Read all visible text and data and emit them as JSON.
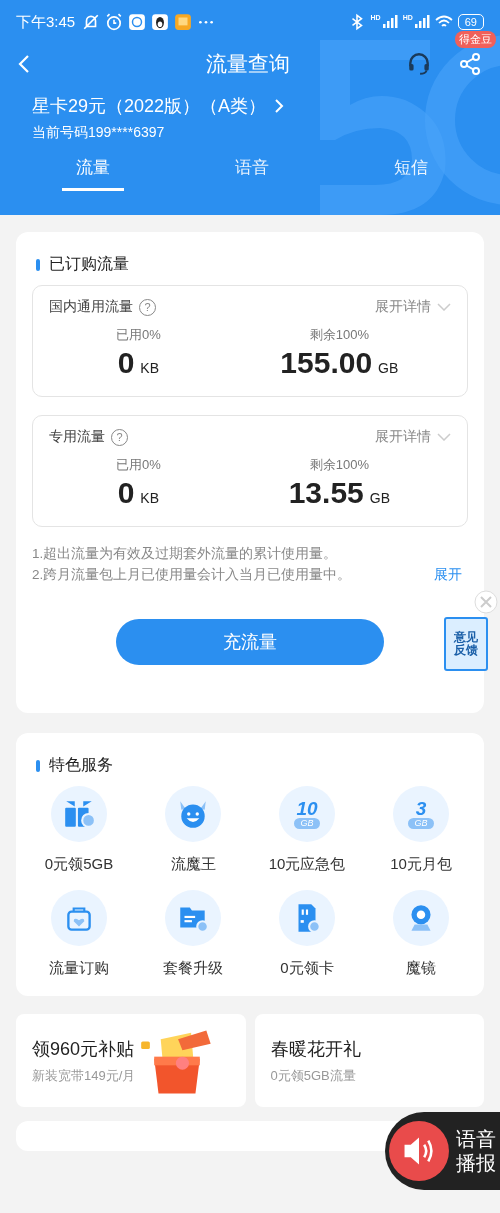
{
  "status_bar": {
    "time": "下午3:45",
    "signal_labels": [
      "HD",
      "HD"
    ],
    "battery": "69"
  },
  "nav": {
    "title": "流量查询",
    "badge": "得金豆"
  },
  "plan": {
    "name": "星卡29元（2022版）（A类）",
    "number": "当前号码199****6397"
  },
  "tabs": [
    {
      "label": "流量",
      "selected": true
    },
    {
      "label": "语音",
      "selected": false
    },
    {
      "label": "短信",
      "selected": false
    }
  ],
  "subscribed": {
    "title": "已订购流量",
    "pools": [
      {
        "name": "国内通用流量",
        "help": "?",
        "toggle": "展开详情",
        "used_label": "已用0%",
        "used_value": "0",
        "used_unit": "KB",
        "remain_label": "剩余100%",
        "remain_value": "155.00",
        "remain_unit": "GB"
      },
      {
        "name": "专用流量",
        "help": "?",
        "toggle": "展开详情",
        "used_label": "已用0%",
        "used_value": "0",
        "used_unit": "KB",
        "remain_label": "剩余100%",
        "remain_value": "13.55",
        "remain_unit": "GB"
      }
    ],
    "notes": [
      "1.超出流量为有效及过期套外流量的累计使用量。",
      "2.跨月流量包上月已使用量会计入当月已使用量中。"
    ],
    "expand": "展开",
    "recharge": "充流量"
  },
  "feedback": {
    "label": "意见反馈"
  },
  "services": {
    "title": "特色服务",
    "items": [
      {
        "kind": "gift",
        "label": "0元领5GB"
      },
      {
        "kind": "devil",
        "label": "流魔王"
      },
      {
        "kind": "gb",
        "number": "10",
        "unit": "GB",
        "label": "10元应急包"
      },
      {
        "kind": "gb",
        "number": "3",
        "unit": "GB",
        "label": "10元月包"
      },
      {
        "kind": "bag",
        "label": "流量订购"
      },
      {
        "kind": "folder",
        "label": "套餐升级"
      },
      {
        "kind": "sim",
        "label": "0元领卡"
      },
      {
        "kind": "camera",
        "label": "魔镜"
      }
    ]
  },
  "promos": [
    {
      "title": "领960元补贴",
      "subtitle": "新装宽带149元/月"
    },
    {
      "title": "春暖花开礼",
      "subtitle": "0元领5GB流量"
    }
  ],
  "voice": {
    "label": "语音播报"
  }
}
